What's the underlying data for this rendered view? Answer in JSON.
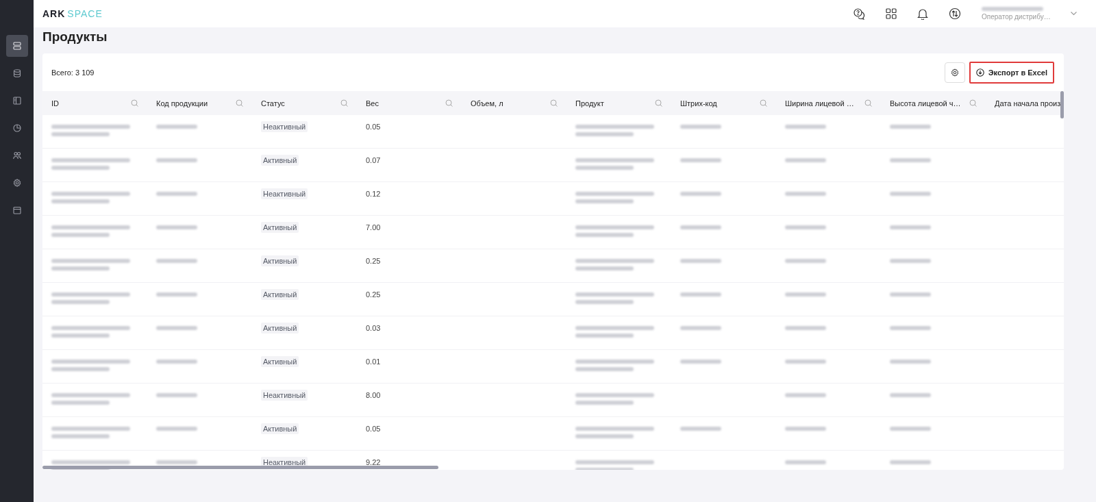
{
  "header": {
    "logo": {
      "left": "ARK",
      "right": "SPACE"
    },
    "user": {
      "role": "Оператор дистрибу…"
    }
  },
  "sidebar": {
    "items": [
      {
        "selected": true
      },
      {
        "selected": false
      },
      {
        "selected": false
      },
      {
        "selected": false
      },
      {
        "selected": false
      },
      {
        "selected": false
      },
      {
        "selected": false
      }
    ]
  },
  "page_title": "Продукты",
  "toolbar": {
    "total": "Всего: 3 109",
    "export_button": "Экспорт в Excel"
  },
  "table": {
    "columns": [
      "ID",
      "Код продукции",
      "Статус",
      "Вес",
      "Объем, л",
      "Продукт",
      "Штрих-код",
      "Ширина лицевой …",
      "Высота лицевой ч…",
      "Дата начала произ"
    ],
    "rows": [
      {
        "status": "Неактивный",
        "weight": "0.05",
        "has_barcode": true
      },
      {
        "status": "Активный",
        "weight": "0.07",
        "has_barcode": true
      },
      {
        "status": "Неактивный",
        "weight": "0.12",
        "has_barcode": true
      },
      {
        "status": "Активный",
        "weight": "7.00",
        "has_barcode": true
      },
      {
        "status": "Активный",
        "weight": "0.25",
        "has_barcode": true
      },
      {
        "status": "Активный",
        "weight": "0.25",
        "has_barcode": true
      },
      {
        "status": "Активный",
        "weight": "0.03",
        "has_barcode": true
      },
      {
        "status": "Активный",
        "weight": "0.01",
        "has_barcode": true
      },
      {
        "status": "Неактивный",
        "weight": "8.00",
        "has_barcode": false
      },
      {
        "status": "Активный",
        "weight": "0.05",
        "has_barcode": true
      },
      {
        "status": "Неактивный",
        "weight": "9.22",
        "has_barcode": false
      }
    ]
  }
}
